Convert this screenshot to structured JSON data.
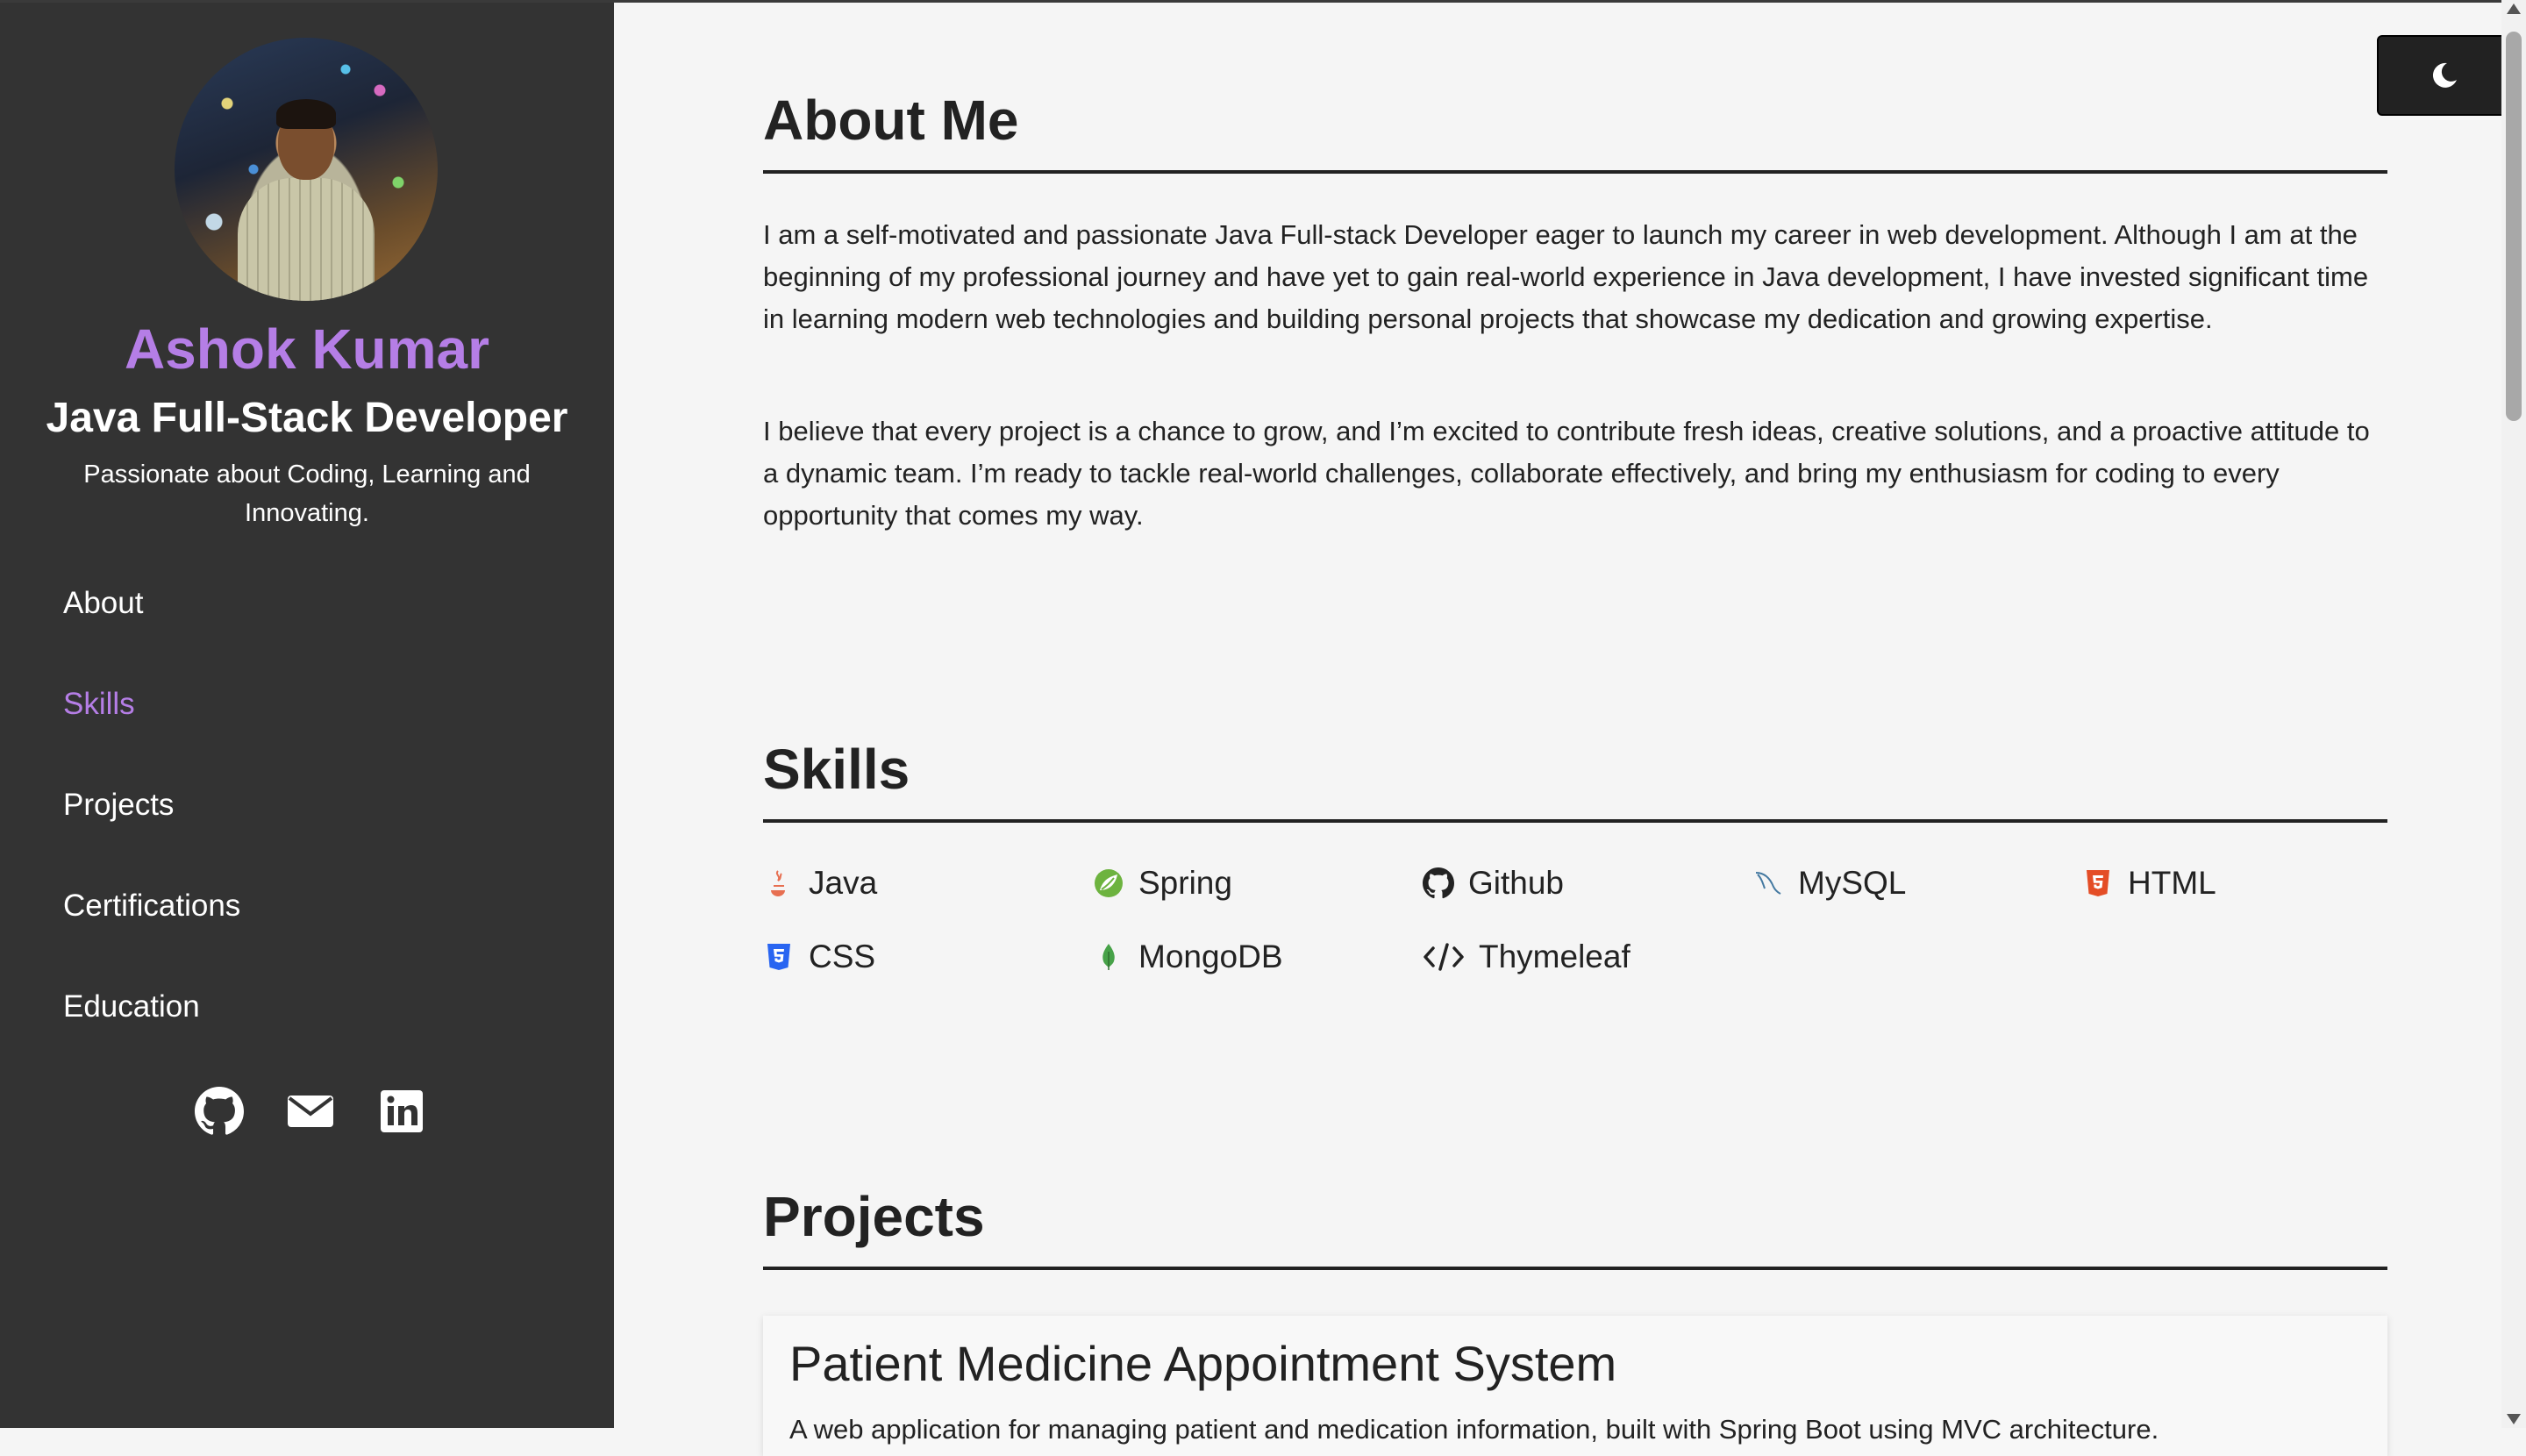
{
  "profile": {
    "name": "Ashok Kumar",
    "role": "Java Full-Stack Developer",
    "tagline": "Passionate about Coding, Learning and Innovating."
  },
  "nav": {
    "items": [
      {
        "label": "About",
        "active": false
      },
      {
        "label": "Skills",
        "active": true
      },
      {
        "label": "Projects",
        "active": false
      },
      {
        "label": "Certifications",
        "active": false
      },
      {
        "label": "Education",
        "active": false
      }
    ]
  },
  "socials": [
    {
      "icon": "github-icon"
    },
    {
      "icon": "mail-icon"
    },
    {
      "icon": "linkedin-icon"
    }
  ],
  "about": {
    "title": "About Me",
    "paragraphs": [
      "I am a self-motivated and passionate Java Full-stack Developer eager to launch my career in web development. Although I am at the beginning of my professional journey and have yet to gain real-world experience in Java development, I have invested significant time in learning modern web technologies and building personal projects that showcase my dedication and growing expertise.",
      "I believe that every project is a chance to grow, and I’m excited to contribute fresh ideas, creative solutions, and a proactive attitude to a dynamic team. I’m ready to tackle real-world challenges, collaborate effectively, and bring my enthusiasm for coding to every opportunity that comes my way."
    ]
  },
  "skills": {
    "title": "Skills",
    "items": [
      {
        "label": "Java",
        "icon": "java-icon"
      },
      {
        "label": "Spring",
        "icon": "spring-icon"
      },
      {
        "label": "Github",
        "icon": "github-icon"
      },
      {
        "label": "MySQL",
        "icon": "mysql-icon"
      },
      {
        "label": "HTML",
        "icon": "html5-icon"
      },
      {
        "label": "CSS",
        "icon": "css3-icon"
      },
      {
        "label": "MongoDB",
        "icon": "mongodb-icon"
      },
      {
        "label": "Thymeleaf",
        "icon": "code-icon"
      }
    ]
  },
  "projects": {
    "title": "Projects",
    "items": [
      {
        "title": "Patient Medicine Appointment System",
        "description": "A web application for managing patient and medication information, built with Spring Boot using MVC architecture."
      }
    ]
  },
  "theme_toggle": {
    "icon": "moon-icon"
  },
  "colors": {
    "sidebar_bg": "#333333",
    "accent": "#b57ee6",
    "page_bg": "#f5f5f5",
    "text": "#222222"
  }
}
